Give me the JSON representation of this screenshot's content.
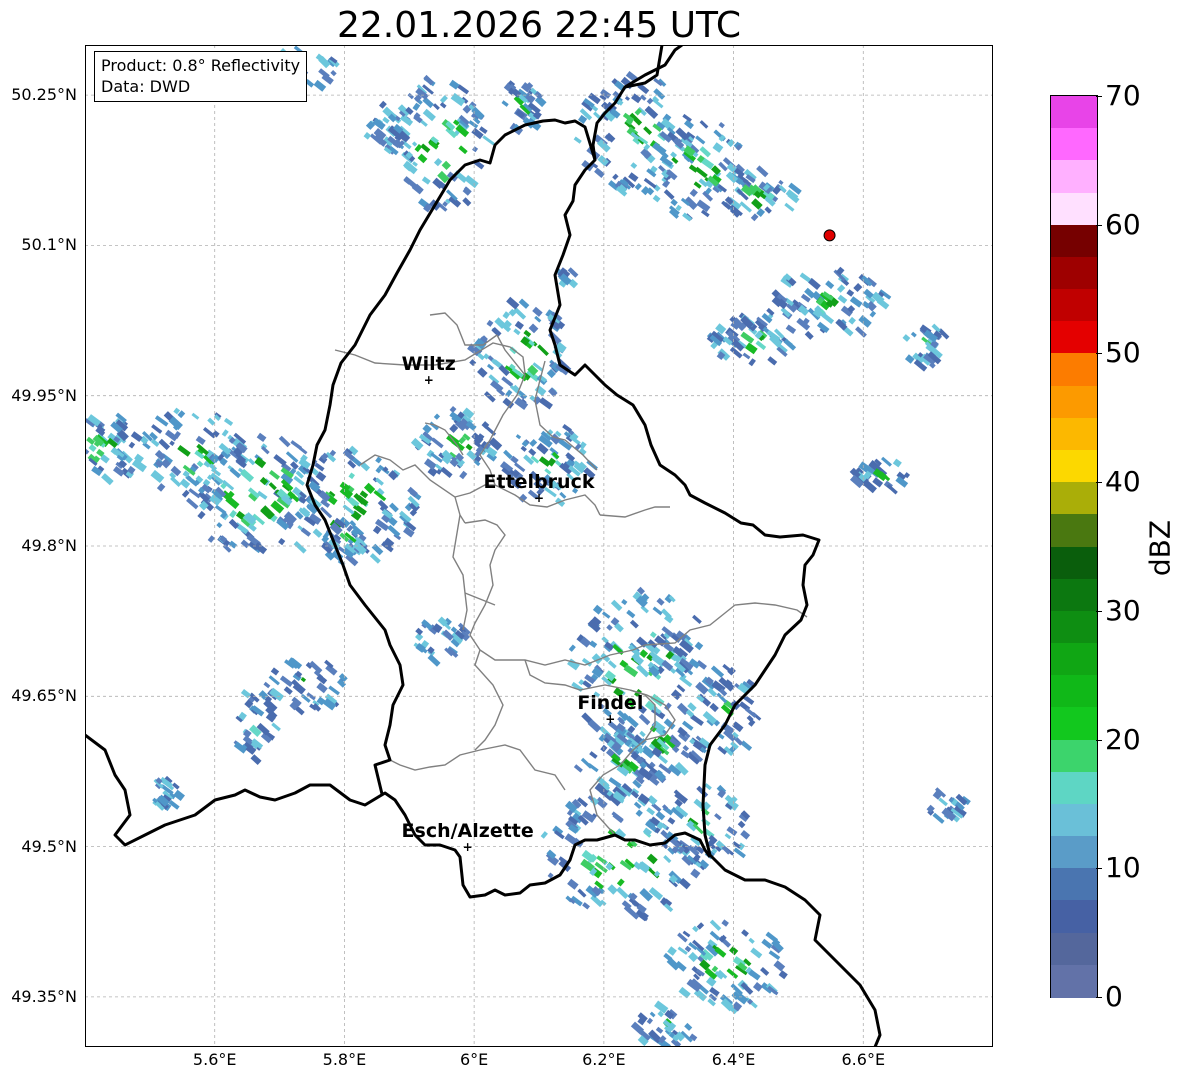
{
  "title": "22.01.2026 22:45 UTC",
  "info": {
    "product": "Product: 0.8° Reflectivity",
    "data": "Data: DWD"
  },
  "axes": {
    "lon_min": 5.4,
    "lon_max": 6.8,
    "lat_min": 49.3,
    "lat_max": 50.3,
    "y_ticks": [
      {
        "value": 50.25,
        "label": "50.25°N"
      },
      {
        "value": 50.1,
        "label": "50.1°N"
      },
      {
        "value": 49.95,
        "label": "49.95°N"
      },
      {
        "value": 49.8,
        "label": "49.8°N"
      },
      {
        "value": 49.65,
        "label": "49.65°N"
      },
      {
        "value": 49.5,
        "label": "49.5°N"
      },
      {
        "value": 49.35,
        "label": "49.35°N"
      }
    ],
    "x_ticks": [
      {
        "value": 5.6,
        "label": "5.6°E"
      },
      {
        "value": 5.8,
        "label": "5.8°E"
      },
      {
        "value": 6.0,
        "label": "6°E"
      },
      {
        "value": 6.2,
        "label": "6.2°E"
      },
      {
        "value": 6.4,
        "label": "6.4°E"
      },
      {
        "value": 6.6,
        "label": "6.6°E"
      }
    ],
    "grid": true
  },
  "cities": [
    {
      "name": "Wiltz",
      "lon": 5.93,
      "lat": 49.966
    },
    {
      "name": "Ettelbruck",
      "lon": 6.1,
      "lat": 49.848
    },
    {
      "name": "Findel",
      "lon": 6.21,
      "lat": 49.627
    },
    {
      "name": "Esch/Alzette",
      "lon": 5.99,
      "lat": 49.5
    }
  ],
  "radar_site": {
    "lon": 6.548,
    "lat": 50.11,
    "color": "#e00000"
  },
  "colorbar": {
    "label": "dBZ",
    "min": 0,
    "max": 70,
    "ticks": [
      "0",
      "10",
      "20",
      "30",
      "40",
      "50",
      "60",
      "70"
    ],
    "colors": [
      "#6272a8",
      "#54679c",
      "#4661a4",
      "#4a75b0",
      "#5a9cc8",
      "#6ac0d8",
      "#5ed6c4",
      "#3cd46c",
      "#12c81e",
      "#10b818",
      "#10a614",
      "#0e8e12",
      "#0c7810",
      "#0a5e0c",
      "#4a7810",
      "#aaae08",
      "#fcd800",
      "#fcb800",
      "#fc9a00",
      "#fc7c00",
      "#e40000",
      "#c00000",
      "#9e0000",
      "#760000",
      "#ffe0ff",
      "#ffb0ff",
      "#ff68ff",
      "#e844e8"
    ]
  },
  "echo_palette": [
    "#4a6cae",
    "#5a7fbd",
    "#4f97c9",
    "#6cc7dc",
    "#66d8c8",
    "#3ecd63",
    "#18bb24",
    "#11a018"
  ]
}
